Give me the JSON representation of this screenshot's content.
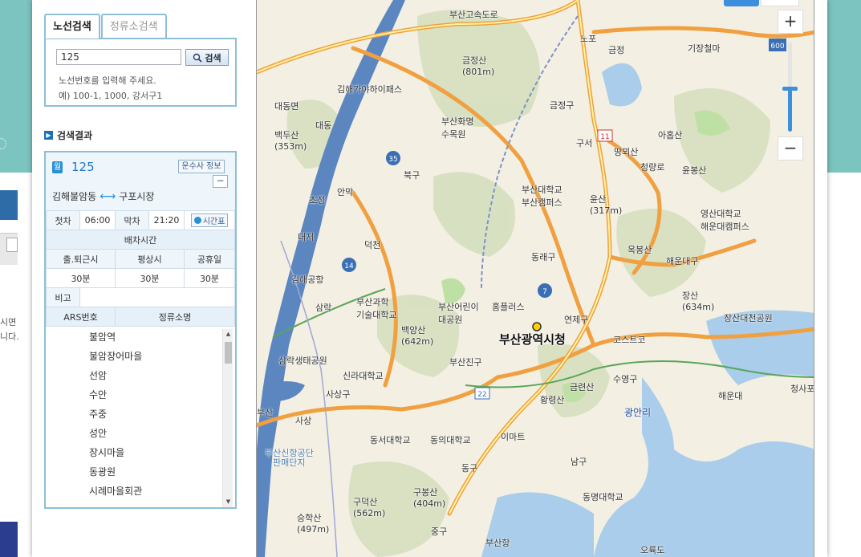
{
  "tabs": [
    {
      "label": "노선검색",
      "active": true
    },
    {
      "label": "정류소검색",
      "active": false
    }
  ],
  "search": {
    "value": "125",
    "button_label": "검색",
    "hint_line1": "노선번호를 입력해 주세요.",
    "hint_line2": "예) 100-1, 1000, 강서구1"
  },
  "results": {
    "title": "검색결과",
    "route": {
      "icon": "월",
      "number": "125",
      "info_button": "운수사 정보",
      "collapse_button": "−",
      "from": "김해불암동",
      "to": "구포시장"
    },
    "schedule": {
      "first_label": "첫차",
      "first_time": "06:00",
      "last_label": "막차",
      "last_time": "21:20",
      "timetable_button": "시간표",
      "interval_header": "배차시간",
      "columns": [
        "출.퇴근시",
        "평상시",
        "공휴일"
      ],
      "intervals": [
        "30분",
        "30분",
        "30분"
      ],
      "note_label": "비고",
      "note_value": ""
    },
    "stop_columns": [
      "ARS번호",
      "정류소명"
    ],
    "stops": [
      "불암역",
      "불암장어마을",
      "선암",
      "수안",
      "주중",
      "성안",
      "장시마을",
      "동광원",
      "시례마을회관"
    ]
  },
  "map": {
    "zoom_in": "+",
    "zoom_out": "−",
    "zoom_level_fraction": 0.5,
    "city_hall_label": "부산광역시청",
    "labels": [
      {
        "text": "금정산\n(801m)"
      },
      {
        "text": "김해가야하이패스"
      },
      {
        "text": "대동면"
      },
      {
        "text": "대동"
      },
      {
        "text": "백두산\n(353m)"
      },
      {
        "text": "부산화명\n수목원"
      },
      {
        "text": "금정구"
      },
      {
        "text": "구서"
      },
      {
        "text": "땅뫼산"
      },
      {
        "text": "아홉산"
      },
      {
        "text": "윤봉산"
      },
      {
        "text": "기장철마"
      },
      {
        "text": "금정"
      },
      {
        "text": "노포"
      },
      {
        "text": "북구"
      },
      {
        "text": "부산대학교\n부산캠퍼스"
      },
      {
        "text": "윤산\n(317m)"
      },
      {
        "text": "영산대학교\n해운대캠퍼스"
      },
      {
        "text": "초정"
      },
      {
        "text": "안막"
      },
      {
        "text": "대저"
      },
      {
        "text": "덕천"
      },
      {
        "text": "동래구"
      },
      {
        "text": "옥봉산"
      },
      {
        "text": "해운대구"
      },
      {
        "text": "장산\n(634m)"
      },
      {
        "text": "장산대천공원"
      },
      {
        "text": "김해공항"
      },
      {
        "text": "부산과학\n기술대학교"
      },
      {
        "text": "삼락"
      },
      {
        "text": "부산어린이\n대공원"
      },
      {
        "text": "홈플러스"
      },
      {
        "text": "연제구"
      },
      {
        "text": "코스트코"
      },
      {
        "text": "백양산\n(642m)"
      },
      {
        "text": "부산진구"
      },
      {
        "text": "삼락생태공원"
      },
      {
        "text": "신라대학교"
      },
      {
        "text": "사상구"
      },
      {
        "text": "금련산"
      },
      {
        "text": "수영구"
      },
      {
        "text": "황령산"
      },
      {
        "text": "해운대"
      },
      {
        "text": "청사포"
      },
      {
        "text": "광안리"
      },
      {
        "text": "사상"
      },
      {
        "text": "동서대학교"
      },
      {
        "text": "동의대학교"
      },
      {
        "text": "이마트"
      },
      {
        "text": "부산"
      },
      {
        "text": "동구"
      },
      {
        "text": "남구"
      },
      {
        "text": "동명대학교"
      },
      {
        "text": "구봉산\n(404m)"
      },
      {
        "text": "구덕산\n(562m)"
      },
      {
        "text": "승학산\n(497m)"
      },
      {
        "text": "중구"
      },
      {
        "text": "부산항"
      },
      {
        "text": "오륙도"
      },
      {
        "text": "부산신항공단"
      },
      {
        "text": "판매단지"
      },
      {
        "text": "부산고속도로"
      },
      {
        "text": "청량로"
      }
    ],
    "road_shields": [
      "35",
      "14",
      "7",
      "11",
      "22",
      "600"
    ]
  },
  "background": {
    "left_fragment_1": "시면",
    "left_fragment_2": "니다."
  },
  "colors": {
    "accent": "#8fbfd6",
    "route_blue": "#1e78c8",
    "highway": "#f0a040",
    "river": "#5b86c0",
    "page_teal": "#7bc4bf"
  }
}
